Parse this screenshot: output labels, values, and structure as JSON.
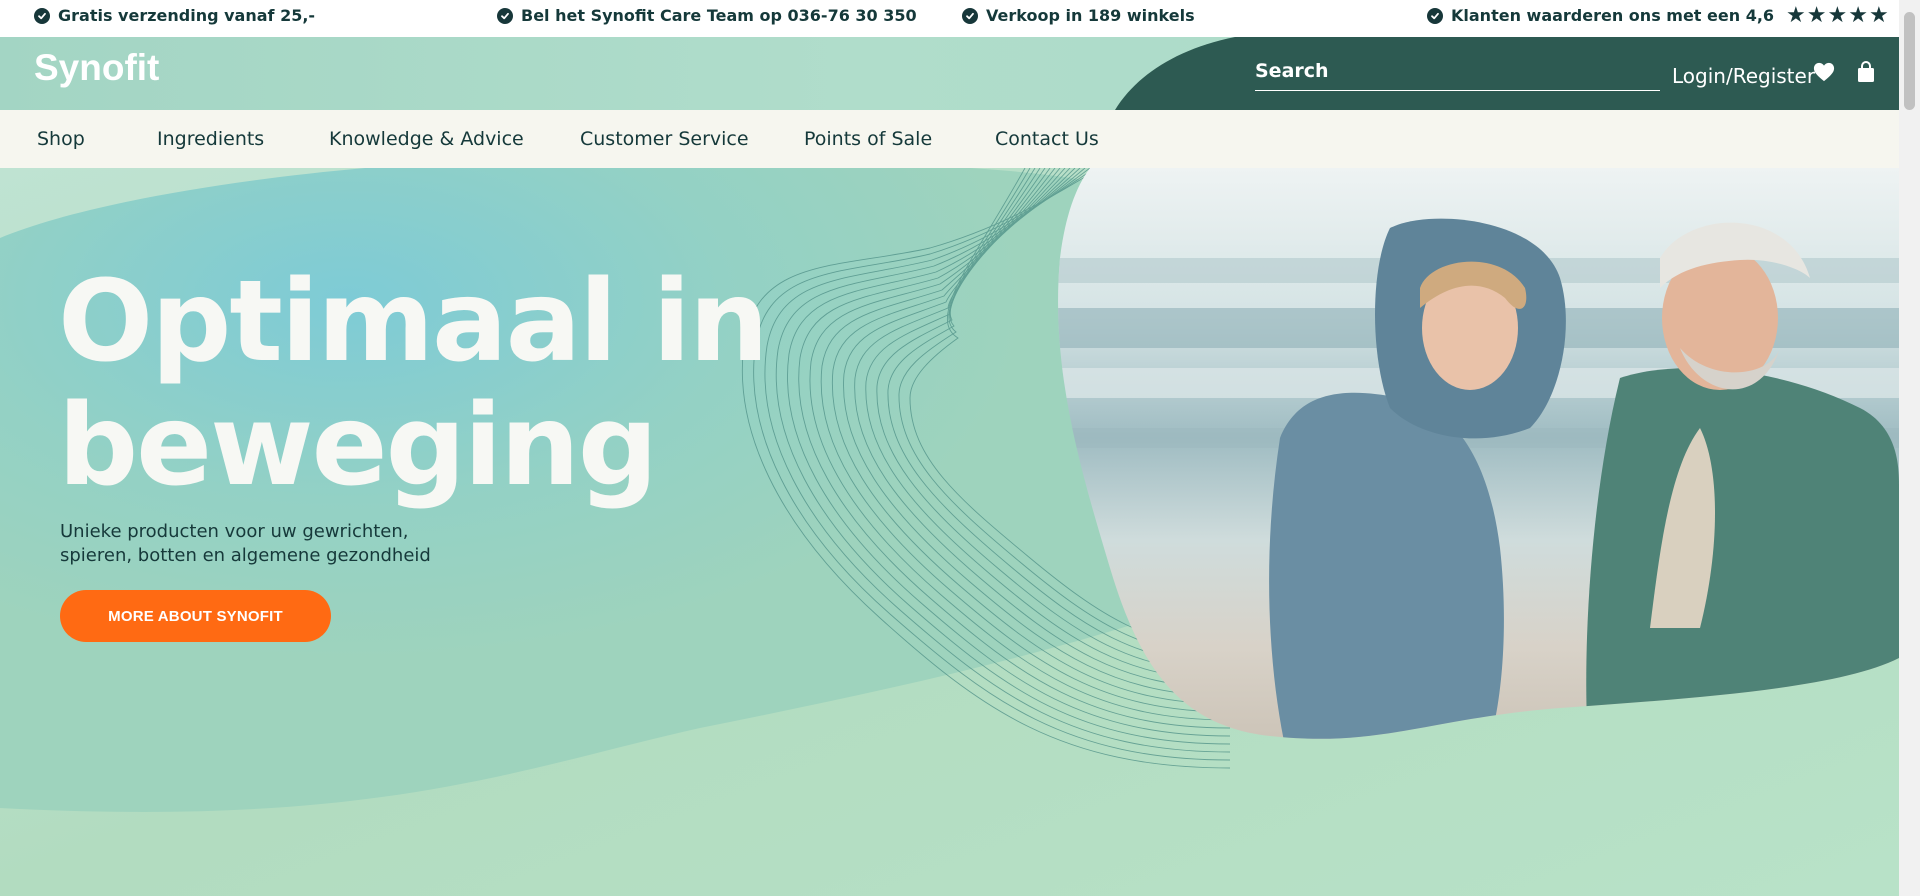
{
  "usp_bar": {
    "items": [
      {
        "text": "Gratis verzending vanaf 25,-"
      },
      {
        "text": "Bel het Synofit Care Team op 036-76 30 350"
      },
      {
        "text": "Verkoop in 189 winkels"
      },
      {
        "text": "Klanten waarderen ons met een 4,6"
      }
    ],
    "rating_stars": 5
  },
  "header": {
    "logo": "Synofit",
    "search_placeholder": "Search",
    "login_label": "Login/Register"
  },
  "nav": {
    "items": [
      "Shop",
      "Ingredients",
      "Knowledge & Advice",
      "Customer Service",
      "Points of Sale",
      "Contact Us"
    ]
  },
  "hero": {
    "title_line1": "Optimaal in",
    "title_line2": "beweging",
    "subtitle_line1": "Unieke producten voor uw gewrichten,",
    "subtitle_line2": "spieren, botten en algemene gezondheid",
    "cta_label": "MORE ABOUT SYNOFIT"
  },
  "colors": {
    "dark_green": "#2d5a52",
    "mint": "#a7d8c5",
    "nav_bg": "#f6f6ef",
    "accent_orange": "#ff6a13",
    "text_dark": "#15393a"
  },
  "icons": {
    "check": "check-circle-icon",
    "star": "star-icon",
    "wishlist": "heart-icon",
    "cart": "shopping-bag-icon"
  }
}
